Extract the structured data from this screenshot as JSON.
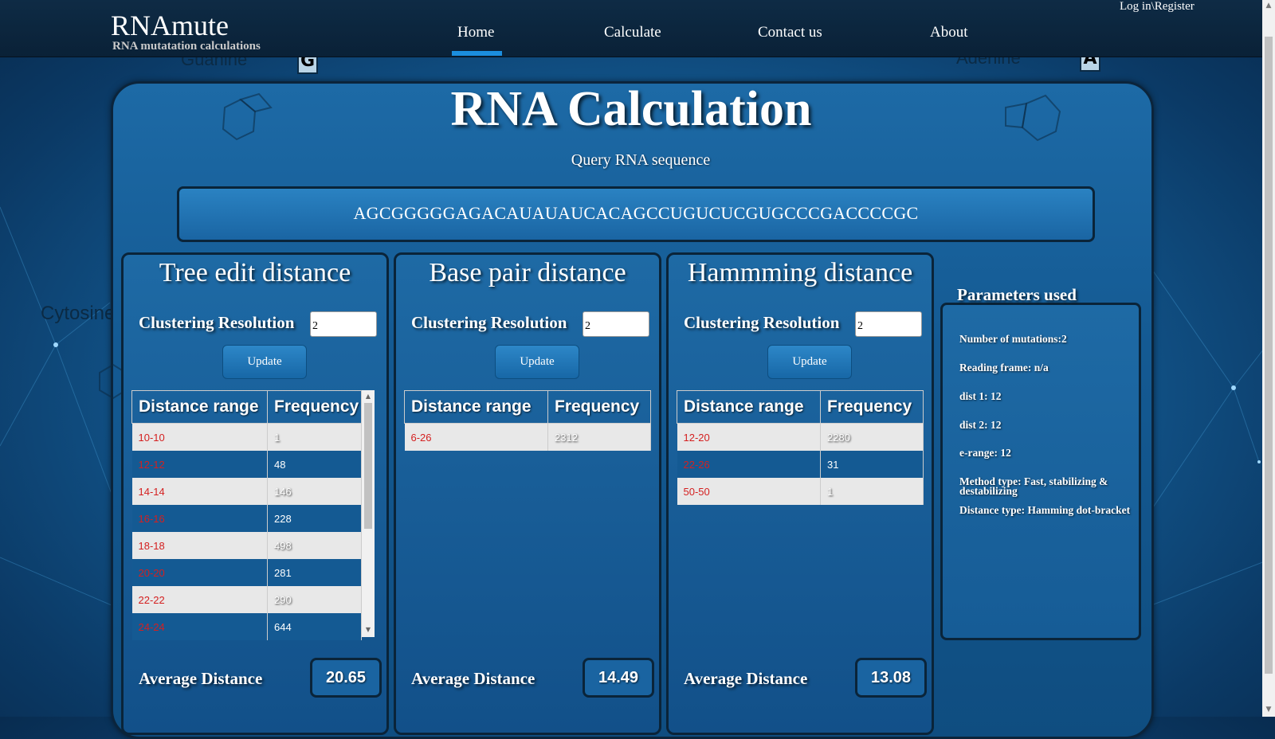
{
  "brand": {
    "name": "RNAmute",
    "tagline": "RNA mutatation calculations"
  },
  "nav": {
    "items": [
      "Home",
      "Calculate",
      "Contact us",
      "About"
    ],
    "active": "Home",
    "login": "Log in\\Register"
  },
  "decor": {
    "guanine": "Guanine",
    "adenine": "Adenine",
    "cytosine": "Cytosine",
    "g_box": "G",
    "a_box": "A"
  },
  "page": {
    "title": "RNA Calculation",
    "query_label": "Query RNA sequence",
    "sequence": "AGCGGGGGAGACAUAUAUCACAGCCUGUCUCGUGCCCGACCCCGC"
  },
  "panels": [
    {
      "title": "Tree edit distance",
      "resolution_label": "Clustering Resolution",
      "resolution_value": "2",
      "update_label": "Update",
      "headers": [
        "Distance range",
        "Frequency"
      ],
      "rows": [
        [
          "10-10",
          "1"
        ],
        [
          "12-12",
          "48"
        ],
        [
          "14-14",
          "146"
        ],
        [
          "16-16",
          "228"
        ],
        [
          "18-18",
          "498"
        ],
        [
          "20-20",
          "281"
        ],
        [
          "22-22",
          "290"
        ],
        [
          "24-24",
          "644"
        ]
      ],
      "avg_label": "Average Distance",
      "avg_value": "20.65"
    },
    {
      "title": "Base pair distance",
      "resolution_label": "Clustering Resolution",
      "resolution_value": "2",
      "update_label": "Update",
      "headers": [
        "Distance range",
        "Frequency"
      ],
      "rows": [
        [
          "6-26",
          "2312"
        ]
      ],
      "avg_label": "Average Distance",
      "avg_value": "14.49"
    },
    {
      "title": "Hammming distance",
      "resolution_label": "Clustering Resolution",
      "resolution_value": "2",
      "update_label": "Update",
      "headers": [
        "Distance range",
        "Frequency"
      ],
      "rows": [
        [
          "12-20",
          "2280"
        ],
        [
          "22-26",
          "31"
        ],
        [
          "50-50",
          "1"
        ]
      ],
      "avg_label": "Average Distance",
      "avg_value": "13.08"
    }
  ],
  "parameters": {
    "title": "Parameters used",
    "items": [
      "Number of mutations:2",
      "Reading frame: n/a",
      "dist 1: 12",
      "dist 2: 12",
      "e-range: 12",
      "Method type: Fast, stabilizing & destabilizing",
      "Distance type: Hamming dot-bracket"
    ]
  },
  "colors": {
    "accent": "#1b8ede",
    "range_text": "#d42020",
    "nav_bg": "#0e2b45"
  }
}
